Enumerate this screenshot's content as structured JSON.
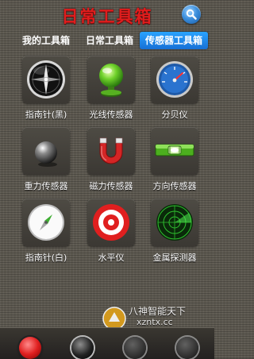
{
  "header": {
    "title": "日常工具箱"
  },
  "tabs": [
    {
      "label": "我的工具箱"
    },
    {
      "label": "日常工具箱"
    },
    {
      "label": "传感器工具箱",
      "active": true
    }
  ],
  "grid": [
    {
      "label": "指南针(黑)",
      "icon": "black-compass-icon"
    },
    {
      "label": "光线传感器",
      "icon": "green-globe-icon"
    },
    {
      "label": "分贝仪",
      "icon": "decibel-gauge-icon"
    },
    {
      "label": "重力传感器",
      "icon": "gravity-ball-icon"
    },
    {
      "label": "磁力传感器",
      "icon": "horseshoe-magnet-icon"
    },
    {
      "label": "方向传感器",
      "icon": "level-bar-icon"
    },
    {
      "label": "指南针(白)",
      "icon": "white-compass-icon"
    },
    {
      "label": "水平仪",
      "icon": "target-icon"
    },
    {
      "label": "金属探测器",
      "icon": "radar-icon"
    }
  ],
  "watermark": {
    "line1": "八神智能天下",
    "line2": "xzntx.cc"
  },
  "colors": {
    "title": "#e01d1d",
    "active_tab": "#1e88e5",
    "background": "#5d5950"
  }
}
